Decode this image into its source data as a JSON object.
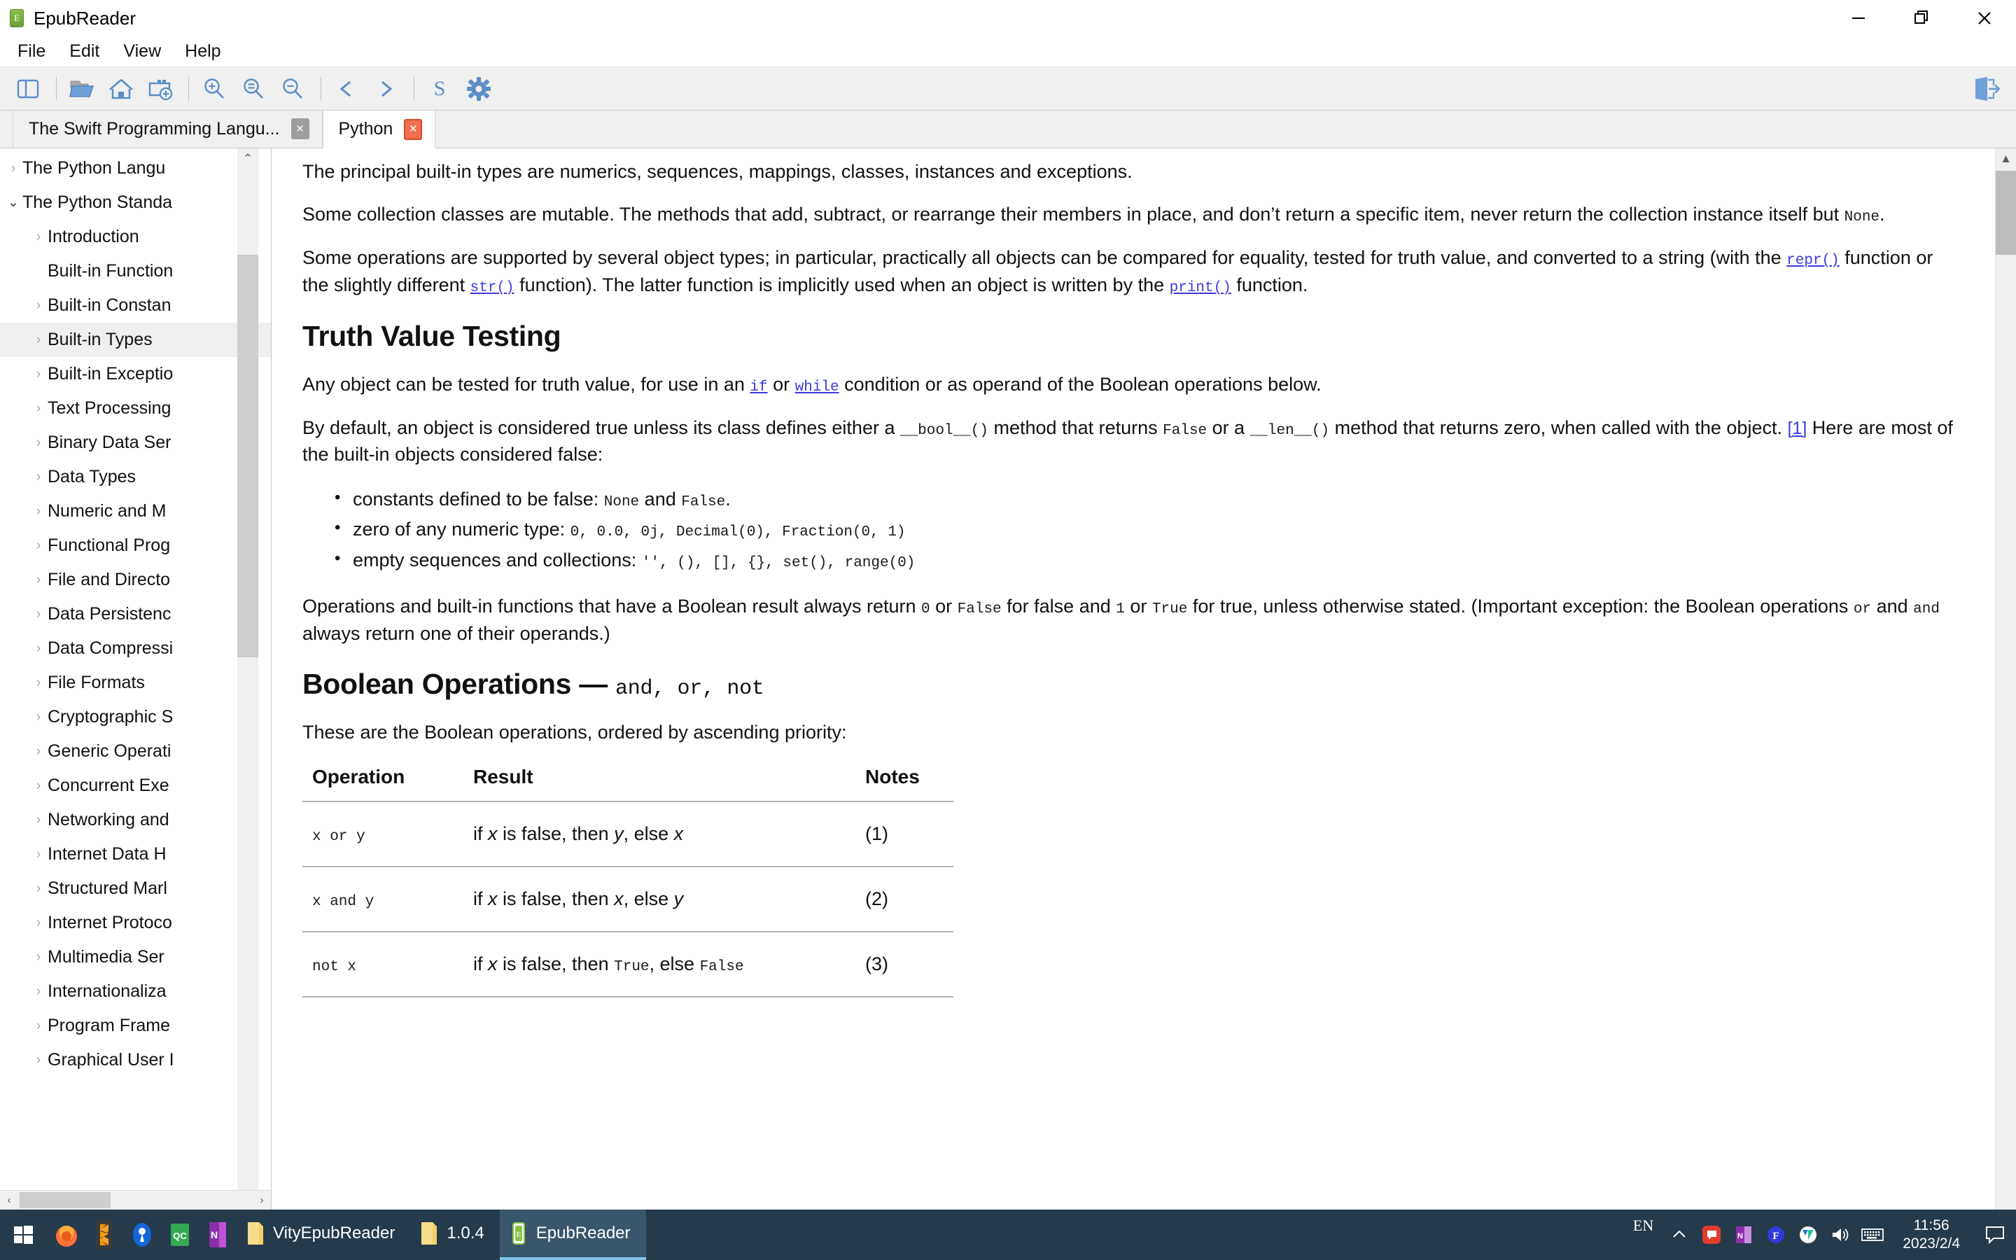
{
  "window": {
    "app_icon": "epub-icon",
    "title": "EpubReader",
    "controls": {
      "minimize": "minimize-icon",
      "maximize": "maximize-icon",
      "close": "close-icon"
    }
  },
  "menubar": {
    "items": [
      "File",
      "Edit",
      "View",
      "Help"
    ]
  },
  "toolbar": {
    "buttons": [
      {
        "name": "toggle-sidebar-icon",
        "title": "Toggle Sidebar"
      },
      {
        "name": "open-folder-icon",
        "title": "Open"
      },
      {
        "name": "home-icon",
        "title": "Home"
      },
      {
        "name": "add-bookmark-icon",
        "title": "Add Bookmark"
      },
      {
        "name": "zoom-in-icon",
        "title": "Zoom In"
      },
      {
        "name": "zoom-reset-icon",
        "title": "Reset Zoom"
      },
      {
        "name": "zoom-out-icon",
        "title": "Zoom Out"
      },
      {
        "name": "prev-icon",
        "title": "Previous",
        "glyph": "<"
      },
      {
        "name": "next-icon",
        "title": "Next",
        "glyph": ">"
      },
      {
        "name": "style-icon",
        "title": "Style",
        "glyph": "S"
      },
      {
        "name": "settings-gear-icon",
        "title": "Settings"
      }
    ],
    "right_button": {
      "name": "exit-icon",
      "title": "Exit"
    }
  },
  "tabs": [
    {
      "label": "The Swift Programming Langu...",
      "active": false,
      "close": "×"
    },
    {
      "label": "Python",
      "active": true,
      "close": "×"
    }
  ],
  "sidebar": {
    "items": [
      {
        "label": "The Python Langu",
        "level": 0,
        "twisty": "collapsed",
        "selected": false
      },
      {
        "label": "The Python Standa",
        "level": 0,
        "twisty": "expanded",
        "selected": false
      },
      {
        "label": "Introduction",
        "level": 1,
        "twisty": "collapsed",
        "selected": false
      },
      {
        "label": "Built-in Function",
        "level": 1,
        "twisty": "none",
        "selected": false
      },
      {
        "label": "Built-in Constan",
        "level": 1,
        "twisty": "collapsed",
        "selected": false
      },
      {
        "label": "Built-in Types",
        "level": 1,
        "twisty": "collapsed",
        "selected": true
      },
      {
        "label": "Built-in Exceptio",
        "level": 1,
        "twisty": "collapsed",
        "selected": false
      },
      {
        "label": "Text Processing",
        "level": 1,
        "twisty": "collapsed",
        "selected": false
      },
      {
        "label": "Binary Data Ser",
        "level": 1,
        "twisty": "collapsed",
        "selected": false
      },
      {
        "label": "Data Types",
        "level": 1,
        "twisty": "collapsed",
        "selected": false
      },
      {
        "label": "Numeric and M",
        "level": 1,
        "twisty": "collapsed",
        "selected": false
      },
      {
        "label": "Functional Prog",
        "level": 1,
        "twisty": "collapsed",
        "selected": false
      },
      {
        "label": "File and Directo",
        "level": 1,
        "twisty": "collapsed",
        "selected": false
      },
      {
        "label": "Data Persistenc",
        "level": 1,
        "twisty": "collapsed",
        "selected": false
      },
      {
        "label": "Data Compressi",
        "level": 1,
        "twisty": "collapsed",
        "selected": false
      },
      {
        "label": "File Formats",
        "level": 1,
        "twisty": "collapsed",
        "selected": false
      },
      {
        "label": "Cryptographic S",
        "level": 1,
        "twisty": "collapsed",
        "selected": false
      },
      {
        "label": "Generic Operati",
        "level": 1,
        "twisty": "collapsed",
        "selected": false
      },
      {
        "label": "Concurrent Exe",
        "level": 1,
        "twisty": "collapsed",
        "selected": false
      },
      {
        "label": "Networking and",
        "level": 1,
        "twisty": "collapsed",
        "selected": false
      },
      {
        "label": "Internet Data H",
        "level": 1,
        "twisty": "collapsed",
        "selected": false
      },
      {
        "label": "Structured Marl",
        "level": 1,
        "twisty": "collapsed",
        "selected": false
      },
      {
        "label": "Internet Protoco",
        "level": 1,
        "twisty": "collapsed",
        "selected": false
      },
      {
        "label": "Multimedia Ser",
        "level": 1,
        "twisty": "collapsed",
        "selected": false
      },
      {
        "label": "Internationaliza",
        "level": 1,
        "twisty": "collapsed",
        "selected": false
      },
      {
        "label": "Program Frame",
        "level": 1,
        "twisty": "collapsed",
        "selected": false
      },
      {
        "label": "Graphical User I",
        "level": 1,
        "twisty": "collapsed",
        "selected": false
      }
    ],
    "scroll_up": "⌃",
    "scroll_down": "⌄",
    "scroll_left": "‹",
    "scroll_right": "›"
  },
  "content": {
    "p1": "The principal built-in types are numerics, sequences, mappings, classes, instances and exceptions.",
    "p2_a": "Some collection classes are mutable. The methods that add, subtract, or rearrange their members in place, and don’t return a specific item, never return the collection instance itself but ",
    "p2_code": "None",
    "p2_b": ".",
    "p3_a": "Some operations are supported by several object types; in particular, practically all objects can be compared for equality, tested for truth value, and converted to a string (with the ",
    "p3_link1": "repr()",
    "p3_b": " function or the slightly different ",
    "p3_link2": "str()",
    "p3_c": " function). The latter function is implicitly used when an object is written by the ",
    "p3_link3": "print()",
    "p3_d": " function.",
    "h1_truth": "Truth Value Testing",
    "p4_a": "Any object can be tested for truth value, for use in an ",
    "p4_code1": "if",
    "p4_b": " or ",
    "p4_code2": "while",
    "p4_c": " condition or as operand of the Boolean operations below.",
    "p5_a": "By default, an object is considered true unless its class defines either a ",
    "p5_code1": "__bool__()",
    "p5_b": " method that returns ",
    "p5_code2": "False",
    "p5_c": " or a ",
    "p5_code3": "__len__()",
    "p5_d": " method that returns zero, when called with the object. ",
    "p5_footnote": "[1]",
    "p5_e": " Here are most of the built-in objects considered false:",
    "bullets": [
      {
        "text_a": "constants defined to be false: ",
        "code1": "None",
        "text_b": " and ",
        "code2": "False",
        "text_c": "."
      },
      {
        "text_a": "zero of any numeric type: ",
        "code1": "0, 0.0, 0j, Decimal(0), Fraction(0, 1)",
        "text_b": "",
        "code2": "",
        "text_c": ""
      },
      {
        "text_a": "empty sequences and collections: ",
        "code1": "'', (), [], {}, set(), range(0)",
        "text_b": "",
        "code2": "",
        "text_c": ""
      }
    ],
    "p6_a": "Operations and built-in functions that have a Boolean result always return ",
    "p6_code1": "0",
    "p6_b": " or ",
    "p6_code2": "False",
    "p6_c": " for false and ",
    "p6_code3": "1",
    "p6_d": " or ",
    "p6_code4": "True",
    "p6_e": " for true, unless otherwise stated. (Important exception: the Boolean operations ",
    "p6_code5": "or",
    "p6_f": " and ",
    "p6_code6": "and",
    "p6_g": " always return one of their operands.)",
    "h1_boolean_main": "Boolean Operations — ",
    "h1_boolean_code": "and, or, not",
    "p7": "These are the Boolean operations, ordered by ascending priority:",
    "table": {
      "headers": [
        "Operation",
        "Result",
        "Notes"
      ],
      "rows": [
        {
          "op": "x or y",
          "res_a": "if ",
          "res_x": "x",
          "res_b": " is false, then ",
          "res_y": "y",
          "res_c": ", else ",
          "res_z": "x",
          "notes": "(1)"
        },
        {
          "op": "x and y",
          "res_a": "if ",
          "res_x": "x",
          "res_b": " is false, then ",
          "res_y": "x",
          "res_c": ", else ",
          "res_z": "y",
          "notes": "(2)"
        },
        {
          "op": "not x",
          "res_a": "if ",
          "res_x": "x",
          "res_b": " is false, then ",
          "res_y": "True",
          "res_c": ", else ",
          "res_z": "False",
          "notes": "(3)"
        }
      ]
    }
  },
  "taskbar": {
    "start": "windows-start-icon",
    "pinned": [
      {
        "name": "firefox-icon"
      },
      {
        "name": "sublime-text-icon"
      },
      {
        "name": "location-app-icon"
      },
      {
        "name": "qc-app-icon",
        "label": "QC"
      },
      {
        "name": "onenote-icon",
        "label": "N"
      }
    ],
    "tasks": [
      {
        "name": "folder-vityepubreader",
        "label": "VityEpubReader",
        "active": false
      },
      {
        "name": "folder-version",
        "label": "1.0.4",
        "active": false
      },
      {
        "name": "app-epubreader",
        "label": "EpubReader",
        "active": true
      }
    ],
    "tray": {
      "language": "EN",
      "chevron": "show-hidden-icons-icon",
      "icons": [
        "qq-icon",
        "onenote-tray-icon",
        "f-app-icon",
        "v-app-icon",
        "volume-icon",
        "keyboard-icon"
      ],
      "time": "11:56",
      "date": "2023/2/4",
      "action_center": "notification-icon"
    }
  },
  "colors": {
    "accent_blue": "#5b8dc7",
    "taskbar_bg": "#253a4a",
    "taskbar_active": "#39566b",
    "link": "#3b3bdd",
    "tab_close_active": "#ef7051",
    "selection": "#efefef"
  }
}
